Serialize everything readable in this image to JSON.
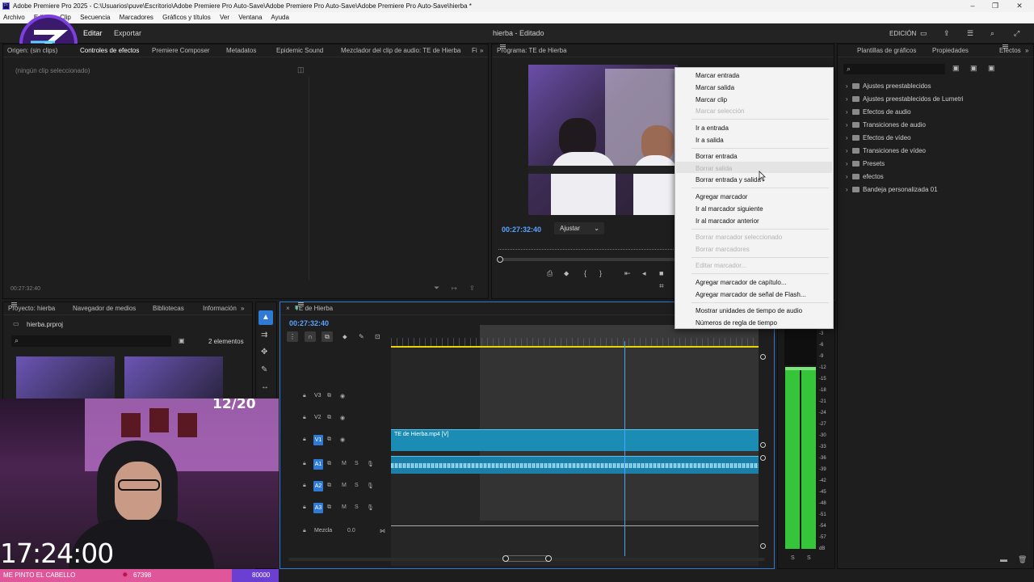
{
  "titlebar": {
    "title": "Adobe Premiere Pro 2025 - C:\\Usuarios\\puve\\Escritorio\\Adobe Premiere Pro Auto-Save\\Adobe Premiere Pro Auto-Save\\Adobe Premiere Pro Auto-Save\\hierba *"
  },
  "menubar": {
    "items": [
      "Archivo",
      "Editar",
      "Clip",
      "Secuencia",
      "Marcadores",
      "Gráficos y títulos",
      "Ver",
      "Ventana",
      "Ayuda"
    ]
  },
  "header": {
    "tab_edit": "Editar",
    "tab_export": "Exportar",
    "doc_title": "hierba - Editado",
    "workspace": "EDICIÓN"
  },
  "source_panel": {
    "tabs": [
      "Origen: (sin clips)",
      "Controles de efectos",
      "Premiere Composer",
      "Metadatos",
      "Epidemic Sound",
      "Mezclador del clip de audio: TE de Hierba",
      "Fi"
    ],
    "no_clip": "(ningún clip seleccionado)",
    "timecode": "00:27:32:40"
  },
  "program": {
    "tab": "Programa: TE de Hierba",
    "timecode": "00:27:32:40",
    "fit": "Ajustar"
  },
  "context_menu": {
    "items": [
      {
        "label": "Marcar entrada",
        "enabled": true
      },
      {
        "label": "Marcar salida",
        "enabled": true
      },
      {
        "label": "Marcar clip",
        "enabled": true
      },
      {
        "label": "Marcar selección",
        "enabled": false
      },
      {
        "label": "Ir a entrada",
        "enabled": true
      },
      {
        "label": "Ir a salida",
        "enabled": true
      },
      {
        "label": "Borrar entrada",
        "enabled": true
      },
      {
        "label": "Borrar salida",
        "enabled": false
      },
      {
        "label": "Borrar entrada y salida",
        "enabled": true
      },
      {
        "label": "Agregar marcador",
        "enabled": true
      },
      {
        "label": "Ir al marcador siguiente",
        "enabled": true
      },
      {
        "label": "Ir al marcador anterior",
        "enabled": true
      },
      {
        "label": "Borrar marcador seleccionado",
        "enabled": false
      },
      {
        "label": "Borrar marcadores",
        "enabled": false
      },
      {
        "label": "Editar marcador...",
        "enabled": false
      },
      {
        "label": "Agregar marcador de capítulo...",
        "enabled": true
      },
      {
        "label": "Agregar marcador de señal de Flash...",
        "enabled": true
      },
      {
        "label": "Mostrar unidades de tiempo de audio",
        "enabled": true
      },
      {
        "label": "Números de regla de tiempo",
        "enabled": true
      }
    ]
  },
  "effects_panel": {
    "tabs": [
      "Plantillas de gráficos",
      "Propiedades",
      "Efectos"
    ],
    "items": [
      "Ajustes preestablecidos",
      "Ajustes preestablecidos de Lumetri",
      "Efectos de audio",
      "Transiciones de audio",
      "Efectos de vídeo",
      "Transiciones de vídeo",
      "Presets",
      "efectos",
      "Bandeja personalizada 01"
    ]
  },
  "project_panel": {
    "tabs": [
      "Proyecto: hierba",
      "Navegador de medios",
      "Bibliotecas",
      "Información"
    ],
    "file": "hierba.prproj",
    "count": "2 elementos"
  },
  "timeline": {
    "tab": "TE de Hierba",
    "timecode": "00:27:32:40",
    "tracks": [
      "V3",
      "V2",
      "V1",
      "A1",
      "A2",
      "A3"
    ],
    "video_clip": "TE de Hierba.mp4 [V]",
    "mix_label": "Mezcla",
    "mix_value": "0.0",
    "playhead_fraction": 0.636
  },
  "audio_meter": {
    "scale": [
      "-3",
      "-6",
      "-9",
      "-12",
      "-15",
      "-18",
      "-21",
      "-24",
      "-27",
      "-30",
      "-33",
      "-36",
      "-39",
      "-42",
      "-45",
      "-48",
      "-51",
      "-54",
      "-57",
      "dB"
    ],
    "footer": [
      "S",
      "S"
    ]
  },
  "overlay": {
    "counter": "12/20",
    "clock": "17:24:00",
    "banner_text": "ME PINTO EL CABELLO",
    "banner_points": "67398",
    "banner_goal": "80000"
  },
  "colors": {
    "accent_blue": "#2e7ad4",
    "clip_video": "#1b8db5",
    "clip_audio": "#1b7fa8",
    "meter_green": "#36c43a",
    "banner_pink": "#e0569b",
    "banner_purple": "#6b3fd1"
  }
}
